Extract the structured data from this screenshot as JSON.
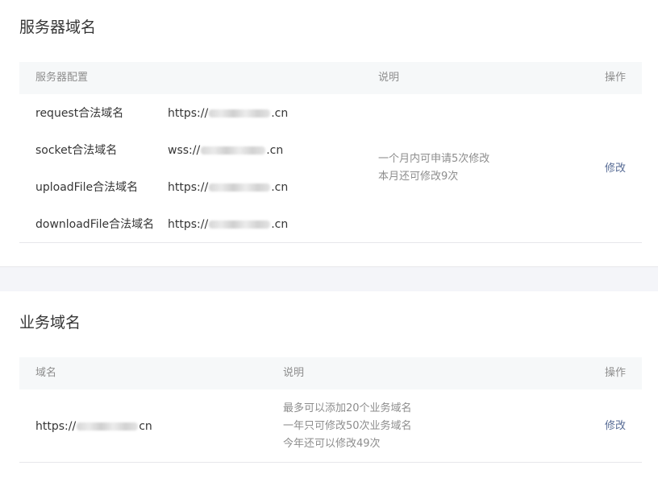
{
  "server_domains": {
    "title": "服务器域名",
    "headers": {
      "config": "服务器配置",
      "desc": "说明",
      "op": "操作"
    },
    "rows": [
      {
        "label": "request合法域名",
        "prefix": "https://",
        "suffix": ".cn"
      },
      {
        "label": "socket合法域名",
        "prefix": "wss://",
        "suffix": ".cn"
      },
      {
        "label": "uploadFile合法域名",
        "prefix": "https://",
        "suffix": ".cn"
      },
      {
        "label": "downloadFile合法域名",
        "prefix": "https://",
        "suffix": ".cn"
      }
    ],
    "desc_lines": [
      "一个月内可申请5次修改",
      "本月还可修改9次"
    ],
    "action": "修改"
  },
  "business_domains": {
    "title": "业务域名",
    "headers": {
      "domain": "域名",
      "desc": "说明",
      "op": "操作"
    },
    "domain": {
      "prefix": "https://",
      "suffix": "cn"
    },
    "desc_lines": [
      "最多可以添加20个业务域名",
      "一年只可修改50次业务域名",
      "今年还可以修改49次"
    ],
    "action": "修改"
  }
}
